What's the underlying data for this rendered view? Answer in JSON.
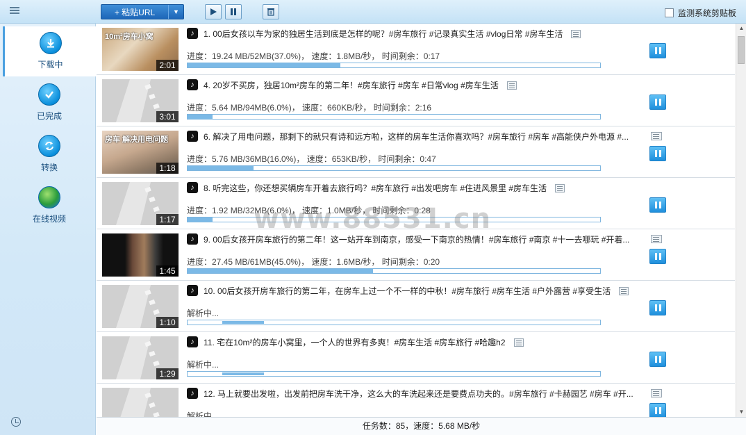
{
  "toolbar": {
    "paste_url_label": "+ 粘贴URL",
    "monitor_clipboard_label": "监测系统剪贴板",
    "monitor_clipboard_checked": false
  },
  "sidebar": {
    "items": [
      {
        "label": "下载中",
        "icon": "download-icon",
        "active": true
      },
      {
        "label": "已完成",
        "icon": "check-icon",
        "active": false
      },
      {
        "label": "转换",
        "icon": "convert-icon",
        "active": false
      },
      {
        "label": "在线视频",
        "icon": "globe-icon",
        "active": false
      }
    ]
  },
  "tasks": [
    {
      "title": "1. 00后女孩以车为家的独居生活到底是怎样的呢？#房车旅行 #记录真实生活 #vlog日常 #房车生活",
      "status": "进度：19.24 MB/52MB(37.0%)，  速度：1.8MB/秒，  时间剩余：0:17",
      "duration": "2:01",
      "progress": 0.37
    },
    {
      "title": "4. 20岁不买房，独居10m²房车的第二年！#房车旅行 #房车 #日常vlog #房车生活",
      "status": "进度：5.64 MB/94MB(6.0%)，  速度：660KB/秒，  时间剩余：2:16",
      "duration": "3:01",
      "progress": 0.06
    },
    {
      "title": "6. 解决了用电问题，那剩下的就只有诗和远方啦，这样的房车生活你喜欢吗？#房车旅行 #房车 #高能侠户外电源 #...",
      "status": "进度：5.76 MB/36MB(16.0%)，  速度：653KB/秒，  时间剩余：0:47",
      "duration": "1:18",
      "progress": 0.16
    },
    {
      "title": "8. 听完这些，你还想买辆房车开着去旅行吗？#房车旅行 #出发吧房车 #住进风景里 #房车生活",
      "status": "进度：1.92 MB/32MB(6.0%)，  速度：1.0MB/秒，  时间剩余：0:28",
      "duration": "1:17",
      "progress": 0.06
    },
    {
      "title": "9. 00后女孩开房车旅行的第二年！这一站开车到南京，感受一下南京的热情！#房车旅行 #南京 #十一去哪玩  #开着...",
      "status": "进度：27.45 MB/61MB(45.0%)，  速度：1.6MB/秒，  时间剩余：0:20",
      "duration": "1:45",
      "progress": 0.45
    },
    {
      "title": "10. 00后女孩开房车旅行的第二年，在房车上过一个不一样的中秋！#房车旅行 #房车生活 #户外露营 #享受生活",
      "status": "解析中...",
      "duration": "1:10",
      "progress": null
    },
    {
      "title": "11. 宅在10m²的房车小窝里，一个人的世界有多爽！#房车生活 #房车旅行 #哈趣h2",
      "status": "解析中...",
      "duration": "1:29",
      "progress": null
    },
    {
      "title": "12. 马上就要出发啦，出发前把房车洗干净，这么大的车洗起来还是要费点功夫的。#房车旅行 #卡赫园艺 #房车 #开...",
      "status": "解析中...",
      "duration": "",
      "progress": null
    }
  ],
  "thumb_overlays": {
    "t1": "10m²房车小窝",
    "t3": "房车 解决用电问题"
  },
  "footer": {
    "summary": "任务数：85，速度：5.68 MB/秒"
  },
  "watermark": "www.88531.cn",
  "colors": {
    "accent": "#1f8fdc",
    "toolbar_button": "#1d66b8",
    "progress": "#7bb9e6"
  }
}
